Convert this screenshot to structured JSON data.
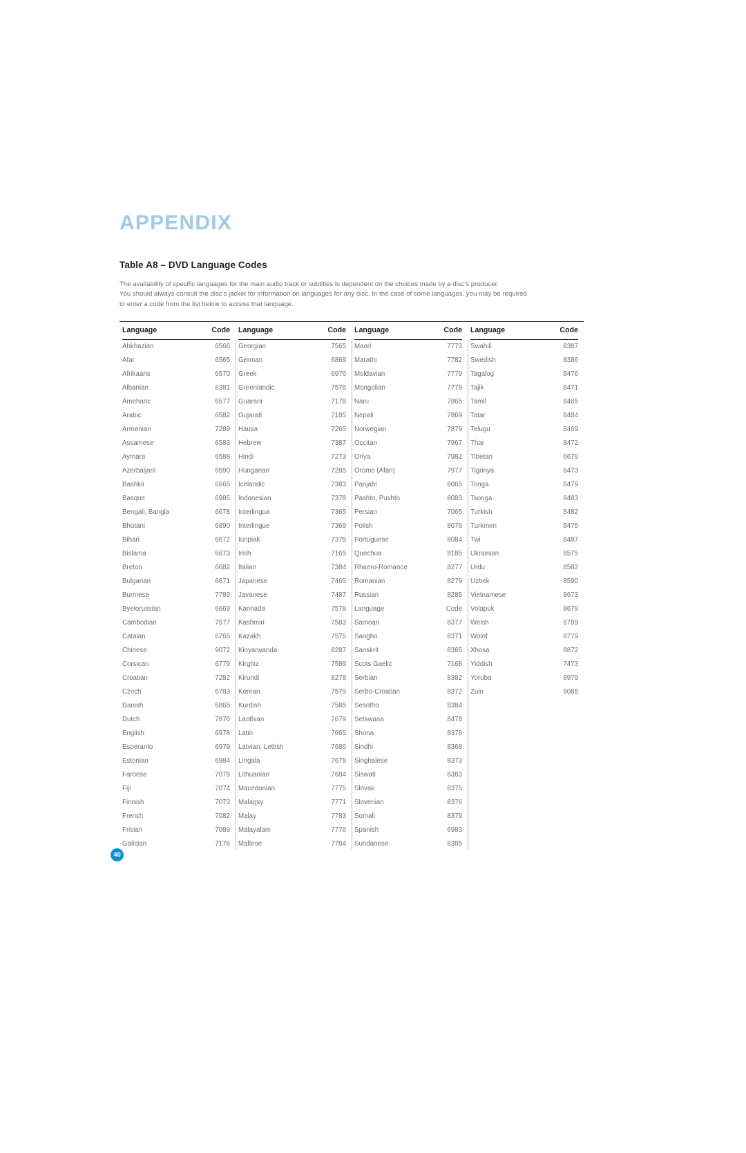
{
  "header": {
    "appendix_title": "APPENDIX",
    "table_title": "Table A8 – DVD Language Codes"
  },
  "intro": {
    "line1": "The availability of specific languages for the main audio track or subtitles is dependent on the choices made by a disc's producer.",
    "line2": "You should always consult the disc's jacket for information on languages for any disc. In the case of some languages, you may be required",
    "line3": "to enter a code from the list below to access that language."
  },
  "page_number": "40",
  "colors": {
    "appendix_blue": "#9ecbea",
    "badge_blue": "#0d8fd0",
    "body_gray": "#6d6e70",
    "rule_black": "#231f20"
  },
  "table": {
    "headers": {
      "language": "Language",
      "code": "Code"
    },
    "columns": [
      {
        "header_language": "Language",
        "header_code": "Code",
        "rows": [
          {
            "language": "Abkhazian",
            "code": "6566"
          },
          {
            "language": "Afar",
            "code": "6565"
          },
          {
            "language": "Afrikaans",
            "code": "6570"
          },
          {
            "language": "Albanian",
            "code": "8381"
          },
          {
            "language": "Ameharic",
            "code": "6577"
          },
          {
            "language": "Arabic",
            "code": "6582"
          },
          {
            "language": "Armenian",
            "code": "7289"
          },
          {
            "language": "Assamese",
            "code": "6583"
          },
          {
            "language": "Aymara",
            "code": "6588"
          },
          {
            "language": "Azerbaijani",
            "code": "6590"
          },
          {
            "language": "Bashkir",
            "code": "6665"
          },
          {
            "language": "Basque",
            "code": "6985"
          },
          {
            "language": "Bengali, Bangla",
            "code": "6678"
          },
          {
            "language": "Bhutani",
            "code": "6890"
          },
          {
            "language": "Bihari",
            "code": "6672"
          },
          {
            "language": "Bislama",
            "code": "6673"
          },
          {
            "language": "Breton",
            "code": "6682"
          },
          {
            "language": "Bulgarian",
            "code": "6671"
          },
          {
            "language": "Burmese",
            "code": "7789"
          },
          {
            "language": "Byelorussian",
            "code": "6669"
          },
          {
            "language": "Cambodian",
            "code": "7577"
          },
          {
            "language": "Catalan",
            "code": "6765"
          },
          {
            "language": "Chinese",
            "code": "9072"
          },
          {
            "language": "Corsican",
            "code": "6779"
          },
          {
            "language": "Croatian",
            "code": "7282"
          },
          {
            "language": "Czech",
            "code": "6783"
          },
          {
            "language": "Danish",
            "code": "6865"
          },
          {
            "language": "Dutch",
            "code": "7876"
          },
          {
            "language": "English",
            "code": "6978"
          },
          {
            "language": "Esperanto",
            "code": "6979"
          },
          {
            "language": "Estonian",
            "code": "6984"
          },
          {
            "language": "Faroese",
            "code": "7079"
          },
          {
            "language": "Fiji",
            "code": "7074"
          },
          {
            "language": "Finnish",
            "code": "7073"
          },
          {
            "language": "French",
            "code": "7082"
          },
          {
            "language": "Frisian",
            "code": "7089"
          },
          {
            "language": "Galician",
            "code": "7176"
          }
        ]
      },
      {
        "header_language": "Language",
        "header_code": "Code",
        "rows": [
          {
            "language": "Georgian",
            "code": "7565"
          },
          {
            "language": "German",
            "code": "6869"
          },
          {
            "language": "Greek",
            "code": "6976"
          },
          {
            "language": "Greenlandic",
            "code": "7576"
          },
          {
            "language": "Guarani",
            "code": "7178"
          },
          {
            "language": "Gujarati",
            "code": "7185"
          },
          {
            "language": "Hausa",
            "code": "7265"
          },
          {
            "language": "Hebrew",
            "code": "7387"
          },
          {
            "language": "Hindi",
            "code": "7273"
          },
          {
            "language": "Hungarian",
            "code": "7285"
          },
          {
            "language": "Icelandic",
            "code": "7383"
          },
          {
            "language": "Indonesian",
            "code": "7378"
          },
          {
            "language": "Interlingua",
            "code": "7365"
          },
          {
            "language": "Interlingue",
            "code": "7369"
          },
          {
            "language": "Iunpiak",
            "code": "7375"
          },
          {
            "language": "Irish",
            "code": "7165"
          },
          {
            "language": "Italian",
            "code": "7384"
          },
          {
            "language": "Japanese",
            "code": "7465"
          },
          {
            "language": "Javanese",
            "code": "7487"
          },
          {
            "language": "Kannada",
            "code": "7578"
          },
          {
            "language": "Kashmiri",
            "code": "7583"
          },
          {
            "language": "Kazakh",
            "code": "7575"
          },
          {
            "language": "Kinyarwanda",
            "code": "8287"
          },
          {
            "language": "Kirghiz",
            "code": "7589"
          },
          {
            "language": "Kirundi",
            "code": "8278"
          },
          {
            "language": "Korean",
            "code": "7579"
          },
          {
            "language": "Kurdish",
            "code": "7585"
          },
          {
            "language": "Laothian",
            "code": "7679"
          },
          {
            "language": "Latin",
            "code": "7665"
          },
          {
            "language": "Latvian, Lettish",
            "code": "7686"
          },
          {
            "language": "Lingala",
            "code": "7678"
          },
          {
            "language": "Lithuanian",
            "code": "7684"
          },
          {
            "language": "Macedonian",
            "code": "7775"
          },
          {
            "language": "Malagsy",
            "code": "7771"
          },
          {
            "language": "Malay",
            "code": "7783"
          },
          {
            "language": "Malayalam",
            "code": "7776"
          },
          {
            "language": "Maltese",
            "code": "7784"
          }
        ]
      },
      {
        "header_language": "Language",
        "header_code": "Code",
        "rows": [
          {
            "language": "Maori",
            "code": "7773"
          },
          {
            "language": "Marathi",
            "code": "7782"
          },
          {
            "language": "Moldavian",
            "code": "7779"
          },
          {
            "language": "Mongolian",
            "code": "7778"
          },
          {
            "language": "Naru",
            "code": "7865"
          },
          {
            "language": "Nepali",
            "code": "7869"
          },
          {
            "language": "Norwegian",
            "code": "7879"
          },
          {
            "language": "Occitan",
            "code": "7967"
          },
          {
            "language": "Oriya",
            "code": "7982"
          },
          {
            "language": "Oromo (Afan)",
            "code": "7977"
          },
          {
            "language": "Panjabi",
            "code": "8065"
          },
          {
            "language": "Pashto, Pushto",
            "code": "8083"
          },
          {
            "language": "Persian",
            "code": "7065"
          },
          {
            "language": "Polish",
            "code": "8076"
          },
          {
            "language": "Portuguese",
            "code": "8084"
          },
          {
            "language": "Quechua",
            "code": "8185"
          },
          {
            "language": "Rhaero-Romance",
            "code": "8277"
          },
          {
            "language": "Romanian",
            "code": "8279"
          },
          {
            "language": "Russian",
            "code": "8285"
          },
          {
            "language": "Language",
            "code": "Code"
          },
          {
            "language": "Samoan",
            "code": "8377"
          },
          {
            "language": "Sangho",
            "code": "8371"
          },
          {
            "language": "Sanskrit",
            "code": "8365"
          },
          {
            "language": "Scots Gaelic",
            "code": "7168"
          },
          {
            "language": "Serbian",
            "code": "8382"
          },
          {
            "language": "Serbo-Croatian",
            "code": "8372"
          },
          {
            "language": "Sesotho",
            "code": "8384"
          },
          {
            "language": "Setswana",
            "code": "8478"
          },
          {
            "language": "Shona",
            "code": "8378"
          },
          {
            "language": "Sindhi",
            "code": "8368"
          },
          {
            "language": "Singhalese",
            "code": "8373"
          },
          {
            "language": "Siswati",
            "code": "8383"
          },
          {
            "language": "Slovak",
            "code": "8375"
          },
          {
            "language": "Slovenian",
            "code": "8376"
          },
          {
            "language": "Somali",
            "code": "8379"
          },
          {
            "language": "Spanish",
            "code": "6983"
          },
          {
            "language": "Sundanese",
            "code": "8385"
          }
        ]
      },
      {
        "header_language": "Language",
        "header_code": "Code",
        "rows": [
          {
            "language": "Swahili",
            "code": "8387"
          },
          {
            "language": "Swedish",
            "code": "8386"
          },
          {
            "language": "Tagalog",
            "code": "8476"
          },
          {
            "language": "Tajik",
            "code": "8471"
          },
          {
            "language": "Tamil",
            "code": "8465"
          },
          {
            "language": "Tatar",
            "code": "8484"
          },
          {
            "language": "Telugu",
            "code": "8469"
          },
          {
            "language": "Thai",
            "code": "8472"
          },
          {
            "language": "Tibetan",
            "code": "6679"
          },
          {
            "language": "Tigrinya",
            "code": "8473"
          },
          {
            "language": "Tonga",
            "code": "8479"
          },
          {
            "language": "Tsonga",
            "code": "8483"
          },
          {
            "language": "Turkish",
            "code": "8482"
          },
          {
            "language": "Turkmen",
            "code": "8475"
          },
          {
            "language": "Twi",
            "code": "8487"
          },
          {
            "language": "Ukrainian",
            "code": "8575"
          },
          {
            "language": "Urdu",
            "code": "8582"
          },
          {
            "language": "Uzbek",
            "code": "8590"
          },
          {
            "language": "Vietnamese",
            "code": "8673"
          },
          {
            "language": "Volapuk",
            "code": "8679"
          },
          {
            "language": "Welsh",
            "code": "6789"
          },
          {
            "language": "Wolof",
            "code": "8779"
          },
          {
            "language": "Xhosa",
            "code": "8872"
          },
          {
            "language": "Yiddish",
            "code": "7473"
          },
          {
            "language": "Yoruba",
            "code": "8979"
          },
          {
            "language": "Zulu",
            "code": "9085"
          }
        ]
      }
    ]
  }
}
